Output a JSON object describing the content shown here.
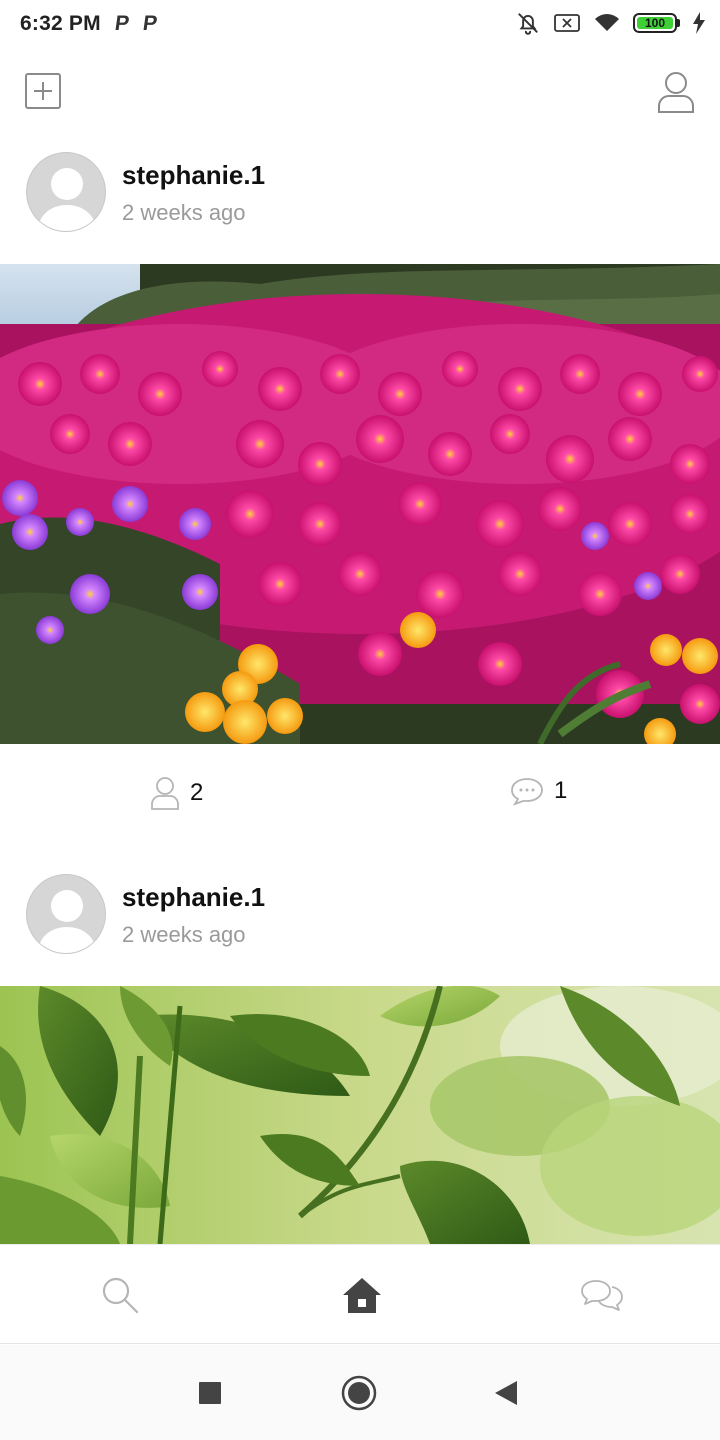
{
  "status_bar": {
    "time": "6:32 PM",
    "notification_icons": [
      "P",
      "P"
    ],
    "battery_level": "100"
  },
  "top_bar": {
    "add_icon": "plus-square-icon",
    "profile_icon": "user-icon"
  },
  "posts": [
    {
      "username": "stephanie.1",
      "time_ago": "2 weeks ago",
      "likes": "2",
      "comments": "1",
      "image": "magenta-flowers-photo"
    },
    {
      "username": "stephanie.1",
      "time_ago": "2 weeks ago",
      "image": "green-leaves-photo"
    }
  ],
  "bottom_nav": {
    "items": [
      "search-icon",
      "home-icon",
      "chat-icon"
    ],
    "active": "home-icon"
  },
  "colors": {
    "text_primary": "#111111",
    "text_secondary": "#9a9a9a",
    "icon_inactive": "#b5b5b5",
    "icon_active": "#444444",
    "battery": "#3fcf37"
  }
}
